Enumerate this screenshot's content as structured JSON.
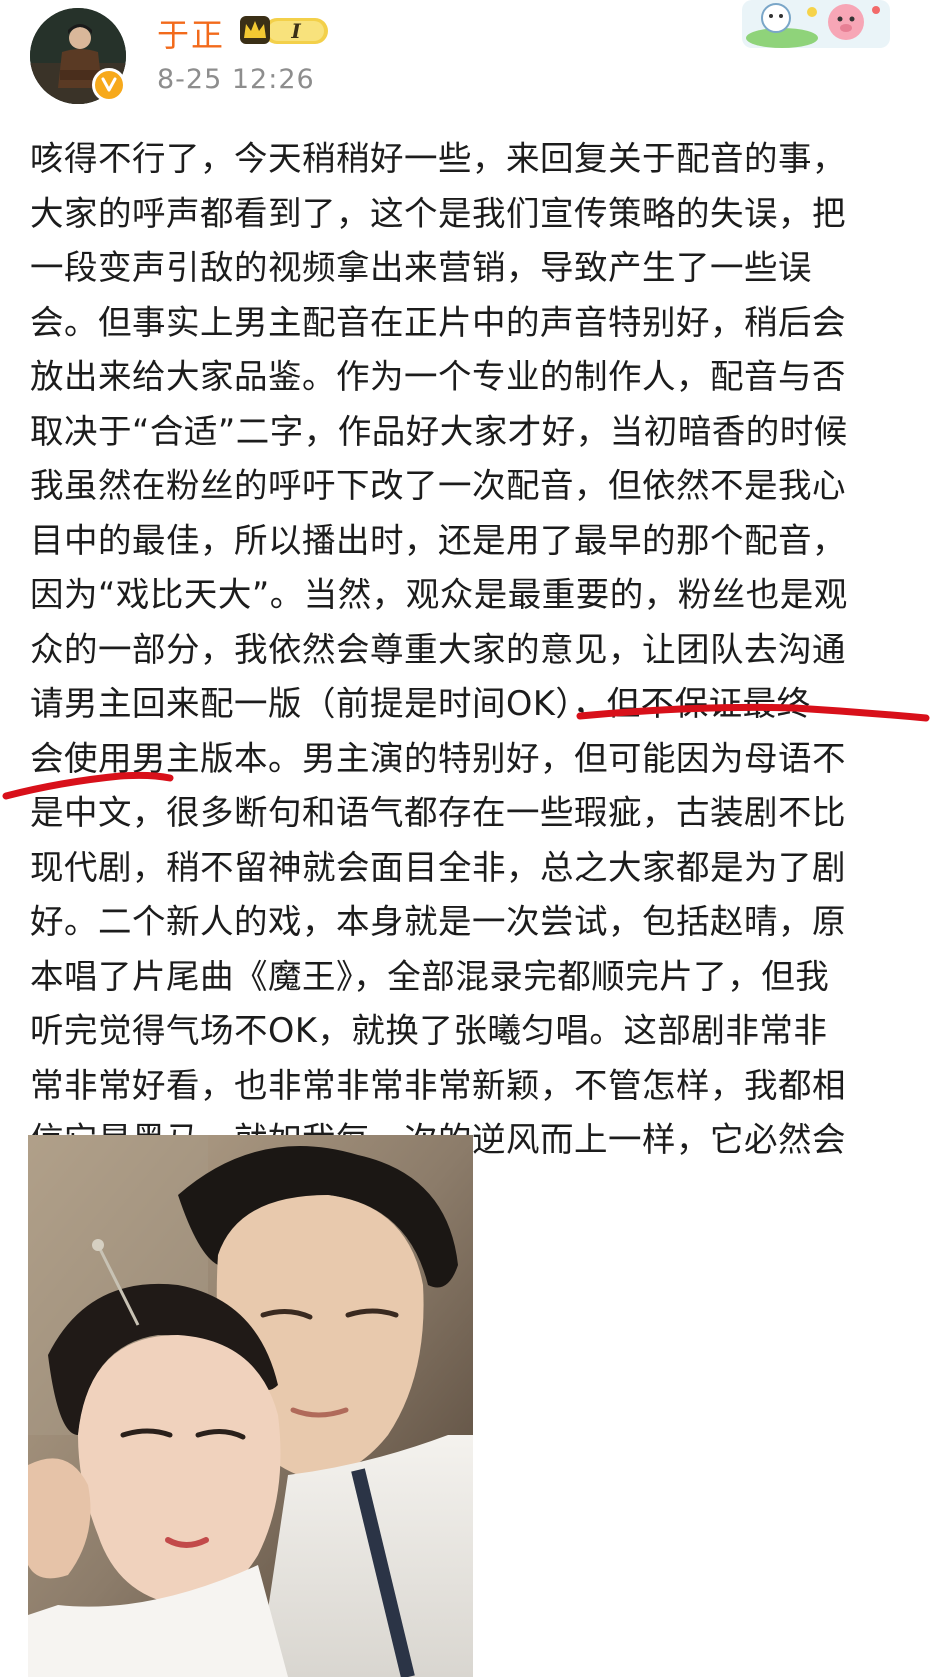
{
  "user": {
    "name": "于正",
    "vip_level": "I",
    "post_time": "8-25 12:26"
  },
  "post": {
    "text": "咳得不行了，今天稍稍好一些，来回复关于配音的事，\n大家的呼声都看到了，这个是我们宣传策略的失误，把\n一段变声引敌的视频拿出来营销，导致产生了一些误\n会。但事实上男主配音在正片中的声音特别好，稍后会\n放出来给大家品鉴。作为一个专业的制作人，配音与否\n取决于“合适”二字，作品好大家才好，当初暗香的时候\n我虽然在粉丝的呼吁下改了一次配音，但依然不是我心\n目中的最佳，所以播出时，还是用了最早的那个配音，\n因为“戏比天大”。当然，观众是最重要的，粉丝也是观\n众的一部分，我依然会尊重大家的意见，让团队去沟通\n请男主回来配一版（前提是时间OK），但不保证最终\n会使用男主版本。男主演的特别好，但可能因为母语不\n是中文，很多断句和语气都存在一些瑕疵，古装剧不比\n现代剧，稍不留神就会面目全非，总之大家都是为了剧\n好。二个新人的戏，本身就是一次尝试，包括赵晴，原\n本唱了片尾曲《魔王》，全部混录完都顺完片了，但我\n听完觉得气场不OK，就换了张曦匀唱。这部剧非常非\n常非常好看，也非常非常非常新颖，不管怎样，我都相\n信它是黑马，就如我每一次的逆风而上一样，它必然会\n光芒万丈。"
  },
  "colors": {
    "username": "#f26a1b",
    "timestamp": "#8d8d8d",
    "text": "#1c1c1c",
    "highlight_underline": "#d8101a",
    "verified_badge": "#f7a91b"
  },
  "icons": {
    "verified": "verified-badge-icon",
    "vip": "vip-crown-badge-icon",
    "decoration": "cartoon-decoration-icon"
  }
}
